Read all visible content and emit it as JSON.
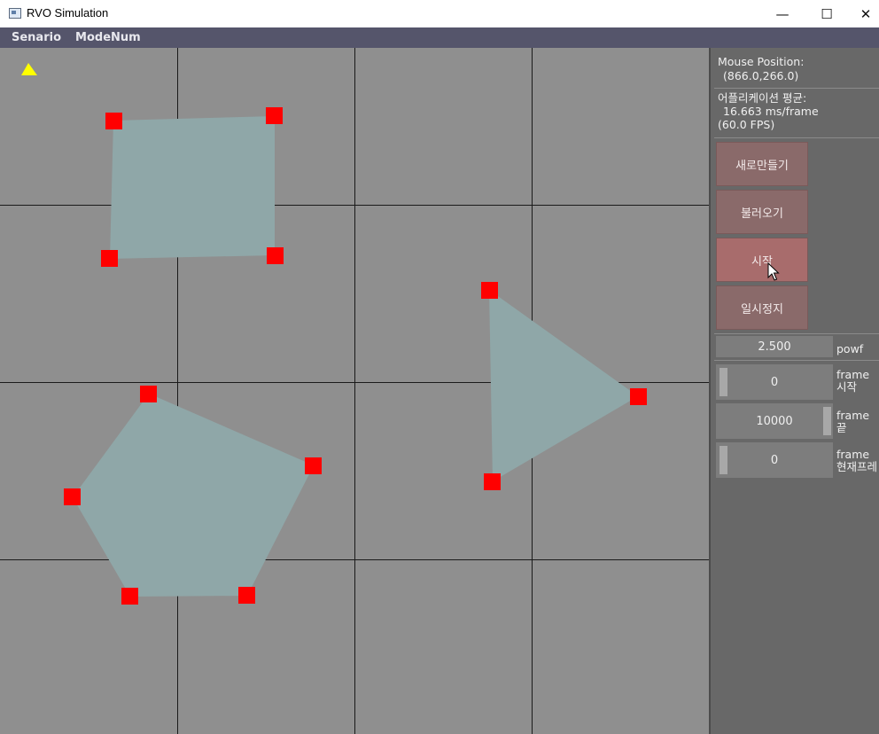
{
  "window": {
    "title": "RVO Simulation",
    "minimize_glyph": "—",
    "maximize_glyph": "☐",
    "close_glyph": "✕"
  },
  "menu": [
    "Senario",
    "ModeNum"
  ],
  "panel": {
    "mouse_label": "Mouse Position:",
    "mouse_value": "(866.0,266.0)",
    "perf_label": "어플리케이션 평균:",
    "perf_ms": "16.663 ms/frame",
    "perf_fps": "(60.0 FPS)",
    "buttons": [
      "새로만들기",
      "불러오기",
      "시작",
      "일시정지"
    ],
    "active_button": "시작",
    "pow_value": "2.500",
    "pow_label": "powf",
    "frame_start_value": "0",
    "frame_start_label_1": "frame",
    "frame_start_label_2": "시작",
    "frame_end_value": "10000",
    "frame_end_label_1": "frame",
    "frame_end_label_2": "끝",
    "frame_current_value": "0",
    "frame_current_label_1": "frame",
    "frame_current_label_2": "현재프레"
  },
  "colors": {
    "canvas": "#8f8f8f",
    "grid": "#1a1a1a",
    "obstacle_fill": "#8fa7a8",
    "vertex": "#ff0000",
    "agent": "#ffff00",
    "menubar": "#55556b",
    "panel": "#686868"
  },
  "icons": {
    "agent": "yellow-triangle-icon",
    "vertex": "red-square-icon",
    "cursor": "arrow-cursor-icon"
  }
}
